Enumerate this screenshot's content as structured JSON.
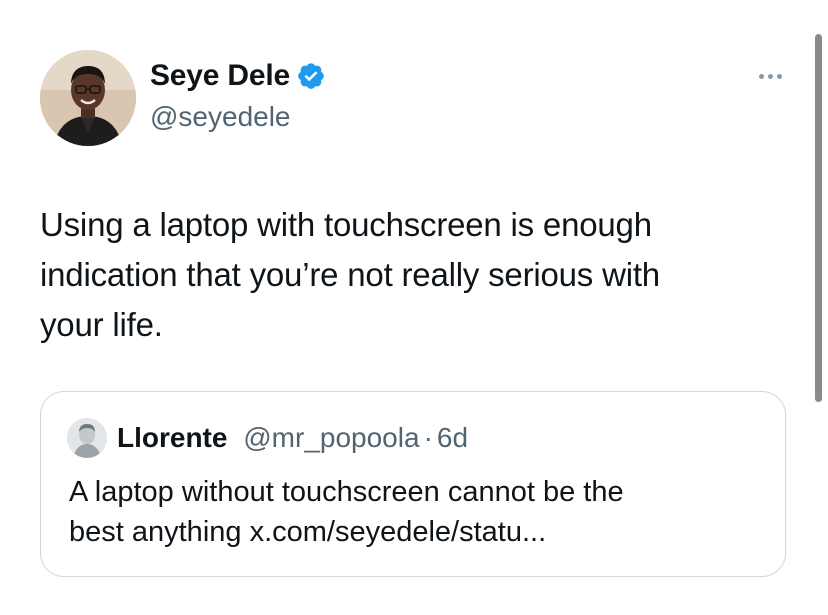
{
  "tweet": {
    "author": {
      "display_name": "Seye Dele",
      "handle": "@seyedele",
      "verified": true,
      "verified_icon": "verified-badge-icon"
    },
    "more_icon": "more-horizontal-icon",
    "text": "Using a laptop with touchscreen is enough\nindication that you’re not really serious with\nyour life.",
    "quote": {
      "display_name": "Llorente",
      "handle": "@mr_popoola",
      "separator": "·",
      "time": "6d",
      "text": "A laptop without touchscreen cannot be the\nbest anything x.com/seyedele/statu..."
    }
  },
  "colors": {
    "text_primary": "#0f1419",
    "text_secondary": "#536471",
    "verified_blue": "#1d9bf0",
    "card_border": "#cfd9de"
  }
}
